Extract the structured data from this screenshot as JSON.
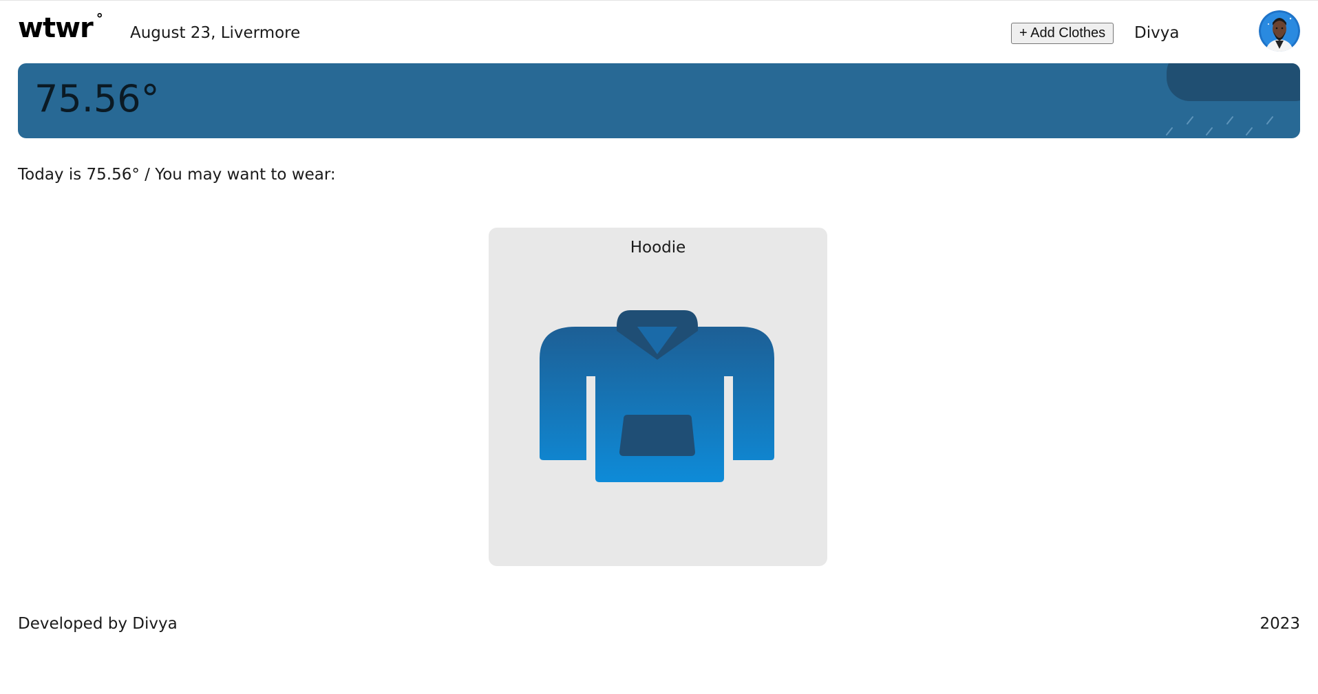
{
  "header": {
    "logo_text": "wtwr",
    "logo_degree": "°",
    "date_location": "August 23, Livermore",
    "add_button_label": "+ Add Clothes",
    "username": "Divya"
  },
  "weather": {
    "temperature": "75.56°",
    "condition_icon": "rain-cloud-icon",
    "banner_color": "#286995"
  },
  "main": {
    "recommendation_text": "Today is 75.56° / You may want to wear:",
    "items": [
      {
        "name": "Hoodie",
        "icon": "hoodie-icon",
        "color": "#1a7fc4"
      }
    ]
  },
  "footer": {
    "credit": "Developed by Divya",
    "year": "2023"
  }
}
